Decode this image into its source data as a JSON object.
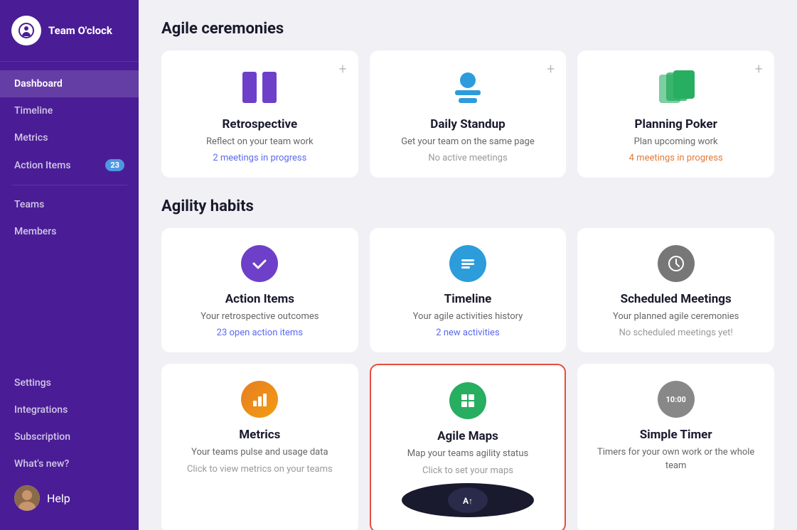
{
  "sidebar": {
    "logo": {
      "text": "Team O'clock"
    },
    "nav_items": [
      {
        "id": "dashboard",
        "label": "Dashboard",
        "active": true,
        "badge": null
      },
      {
        "id": "timeline",
        "label": "Timeline",
        "active": false,
        "badge": null
      },
      {
        "id": "metrics",
        "label": "Metrics",
        "active": false,
        "badge": null
      },
      {
        "id": "action-items",
        "label": "Action Items",
        "active": false,
        "badge": "23"
      },
      {
        "id": "teams",
        "label": "Teams",
        "active": false,
        "badge": null
      },
      {
        "id": "members",
        "label": "Members",
        "active": false,
        "badge": null
      }
    ],
    "bottom_items": [
      {
        "id": "settings",
        "label": "Settings"
      },
      {
        "id": "integrations",
        "label": "Integrations"
      },
      {
        "id": "subscription",
        "label": "Subscription"
      },
      {
        "id": "whats-new",
        "label": "What's new?"
      },
      {
        "id": "help",
        "label": "Help"
      }
    ]
  },
  "main": {
    "agile_ceremonies": {
      "title": "Agile ceremonies",
      "cards": [
        {
          "id": "retrospective",
          "title": "Retrospective",
          "description": "Reflect on your team work",
          "link": "2 meetings in progress",
          "link_color": "blue",
          "has_plus": true,
          "icon": "retro"
        },
        {
          "id": "daily-standup",
          "title": "Daily Standup",
          "description": "Get your team on the same page",
          "link": "No active meetings",
          "link_color": "gray",
          "has_plus": true,
          "icon": "standup"
        },
        {
          "id": "planning-poker",
          "title": "Planning Poker",
          "description": "Plan upcoming work",
          "link": "4 meetings in progress",
          "link_color": "orange",
          "has_plus": true,
          "icon": "poker"
        }
      ]
    },
    "agility_habits": {
      "title": "Agility habits",
      "cards": [
        {
          "id": "action-items",
          "title": "Action Items",
          "description": "Your retrospective outcomes",
          "link": "23 open action items",
          "link_color": "blue",
          "has_plus": false,
          "icon": "checkmark"
        },
        {
          "id": "timeline",
          "title": "Timeline",
          "description": "Your agile activities history",
          "link": "2 new activities",
          "link_color": "blue",
          "has_plus": false,
          "icon": "timeline"
        },
        {
          "id": "scheduled-meetings",
          "title": "Scheduled Meetings",
          "description": "Your planned agile ceremonies",
          "link": "No scheduled meetings yet!",
          "link_color": "gray",
          "has_plus": false,
          "icon": "clock"
        },
        {
          "id": "metrics",
          "title": "Metrics",
          "description": "Your teams pulse and usage data",
          "link": "Click to view metrics on your teams",
          "link_color": "gray",
          "has_plus": false,
          "icon": "metrics"
        },
        {
          "id": "agile-maps",
          "title": "Agile Maps",
          "description": "Map your teams agility status",
          "link": "Click to set your maps",
          "link_color": "gray",
          "has_plus": false,
          "icon": "agile-maps",
          "has_preview": true,
          "outline_red": true
        },
        {
          "id": "simple-timer",
          "title": "Simple Timer",
          "description": "Timers for your own work or the whole team",
          "link": "",
          "link_color": "gray",
          "has_plus": false,
          "icon": "timer",
          "timer_display": "10:00"
        }
      ]
    }
  }
}
